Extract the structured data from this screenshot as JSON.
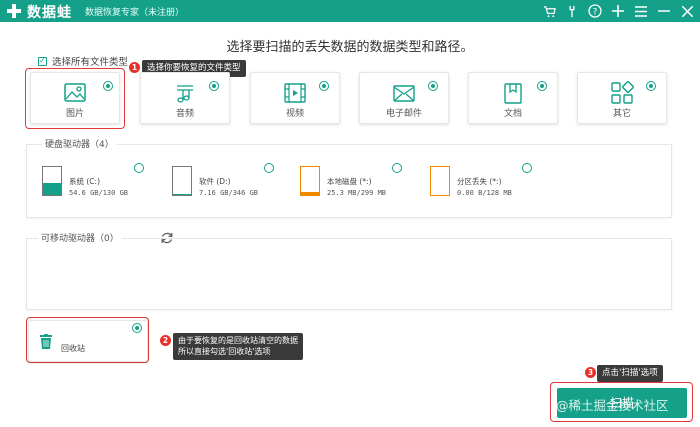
{
  "titlebar": {
    "app_name": "数据蛙",
    "app_subtitle": "数据恢复专家（未注册）",
    "icons": [
      "cart-icon",
      "wrench-icon",
      "help-icon",
      "plus-icon",
      "menu-icon",
      "minimize-icon",
      "close-icon"
    ],
    "icon_glyphs": [
      "🛒",
      "🔧",
      "?",
      "+",
      "≡",
      "—",
      "✕"
    ]
  },
  "heading": "选择要扫描的丢失数据的数据类型和路径。",
  "select_all": {
    "label": "选择所有文件类型",
    "checked": true
  },
  "tooltips": {
    "t1": "选择你要恢复的文件类型",
    "t2_line1": "由于要恢复的是回收站清空的数据",
    "t2_line2": "所以直接勾选'回收站'选项",
    "t3": "点击'扫描'选项"
  },
  "step_numbers": [
    "1",
    "2",
    "3"
  ],
  "file_types": [
    {
      "label": "图片",
      "icon": "image-icon",
      "selected": true
    },
    {
      "label": "音频",
      "icon": "audio-icon",
      "selected": true
    },
    {
      "label": "视频",
      "icon": "video-icon",
      "selected": true
    },
    {
      "label": "电子邮件",
      "icon": "email-icon",
      "selected": true
    },
    {
      "label": "文档",
      "icon": "document-icon",
      "selected": true
    },
    {
      "label": "其它",
      "icon": "other-icon",
      "selected": true
    }
  ],
  "hard_drives": {
    "title": "硬盘驱动器（4）",
    "items": [
      {
        "name": "系统 (C:)",
        "size": "54.6 GB/130 GB",
        "used_fraction": 0.42,
        "color": "#14a089"
      },
      {
        "name": "软件 (D:)",
        "size": "7.16 GB/346 GB",
        "used_fraction": 0.02,
        "color": "#14a089"
      },
      {
        "name": "本地磁盘 (*:)",
        "size": "25.3 MB/299 MB",
        "used_fraction": 0.08,
        "color": "#f08a00"
      },
      {
        "name": "分区丢失 (*:)",
        "size": "0.00  B/128 MB",
        "used_fraction": 0.0,
        "color": "#f08a00"
      }
    ]
  },
  "removable": {
    "title": "可移动驱动器（0）"
  },
  "recycle_bin": {
    "label": "回收站",
    "icon": "recycle-bin-icon",
    "selected": true
  },
  "scan_button": {
    "label": "扫描"
  },
  "watermark": "@稀土掘金技术社区",
  "colors": {
    "accent": "#14a089",
    "highlight": "#e03a3a",
    "orange": "#f08a00",
    "tooltip_bg": "#3a3a3a"
  }
}
